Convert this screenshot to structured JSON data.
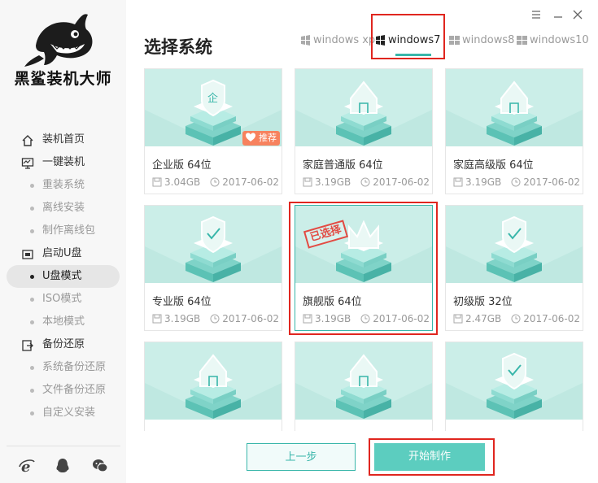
{
  "app": {
    "brand": "黑鲨装机大师",
    "window_controls": {
      "menu_icon": "menu-icon",
      "minimize_icon": "minimize-icon",
      "close_icon": "close-icon"
    }
  },
  "sidebar": {
    "items": [
      {
        "label": "装机首页",
        "level": "top",
        "icon": "home-icon"
      },
      {
        "label": "一键装机",
        "level": "top",
        "icon": "monitor-icon"
      },
      {
        "label": "重装系统",
        "level": "sub"
      },
      {
        "label": "离线安装",
        "level": "sub"
      },
      {
        "label": "制作离线包",
        "level": "sub"
      },
      {
        "label": "启动U盘",
        "level": "top",
        "icon": "usb-icon"
      },
      {
        "label": "U盘模式",
        "level": "sub",
        "active": true
      },
      {
        "label": "ISO模式",
        "level": "sub"
      },
      {
        "label": "本地模式",
        "level": "sub"
      },
      {
        "label": "备份还原",
        "level": "top",
        "icon": "backup-icon"
      },
      {
        "label": "系统备份还原",
        "level": "sub"
      },
      {
        "label": "文件备份还原",
        "level": "sub"
      },
      {
        "label": "自定义安装",
        "level": "sub"
      }
    ],
    "footer_icons": [
      "ie-icon",
      "qq-icon",
      "wechat-icon"
    ]
  },
  "main": {
    "title": "选择系统",
    "tabs": [
      {
        "label": "windows xp",
        "active": false
      },
      {
        "label": "windows7",
        "active": true
      },
      {
        "label": "windows8",
        "active": false
      },
      {
        "label": "windows10",
        "active": false
      }
    ],
    "cards": [
      {
        "name": "企业版 64位",
        "size": "3.04GB",
        "date": "2017-06-02",
        "badge": "推荐",
        "selected": false,
        "art": "shield-企"
      },
      {
        "name": "家庭普通版 64位",
        "size": "3.19GB",
        "date": "2017-06-02",
        "selected": false,
        "art": "house"
      },
      {
        "name": "家庭高级版 64位",
        "size": "3.19GB",
        "date": "2017-06-02",
        "selected": false,
        "art": "house"
      },
      {
        "name": "专业版 64位",
        "size": "3.19GB",
        "date": "2017-06-02",
        "selected": false,
        "art": "check"
      },
      {
        "name": "旗舰版 64位",
        "size": "3.19GB",
        "date": "2017-06-02",
        "selected": true,
        "stamp": "已选择",
        "art": "crown"
      },
      {
        "name": "初级版 32位",
        "size": "2.47GB",
        "date": "2017-06-02",
        "selected": false,
        "art": "check"
      },
      {
        "name": "",
        "size": "",
        "date": "",
        "selected": false,
        "art": "house"
      },
      {
        "name": "",
        "size": "",
        "date": "",
        "selected": false,
        "art": "house"
      },
      {
        "name": "",
        "size": "",
        "date": "",
        "selected": false,
        "art": "check"
      }
    ],
    "buttons": {
      "prev": "上一步",
      "start": "开始制作"
    }
  },
  "colors": {
    "accent": "#39b6aa",
    "button_fill": "#5ccdbf",
    "thumb_bg": "#cbeee8",
    "badge": "#f7825e",
    "stamp": "#e24b43",
    "highlight": "#e0261f"
  }
}
